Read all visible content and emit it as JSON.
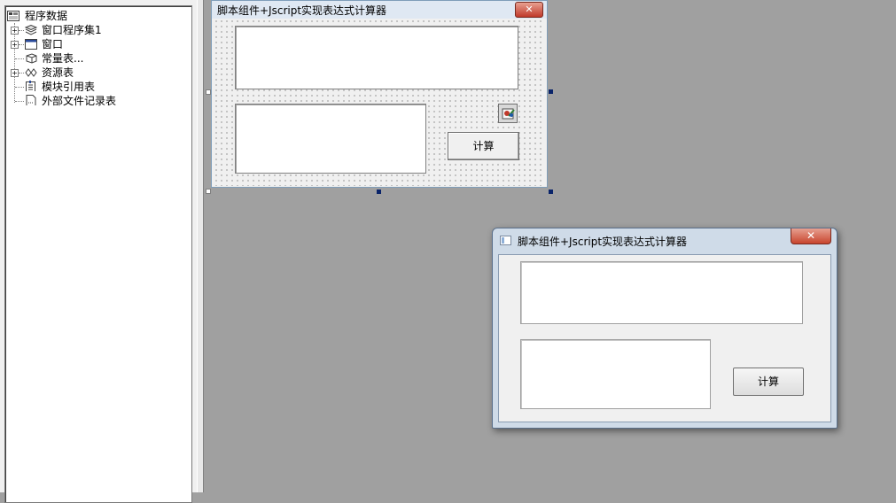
{
  "tree": {
    "root": "程序数据",
    "items": [
      {
        "label": "窗口程序集1",
        "expandable": true,
        "icon": "layers-icon"
      },
      {
        "label": "窗口",
        "expandable": true,
        "icon": "window-icon"
      },
      {
        "label": "常量表...",
        "expandable": false,
        "icon": "constants-icon"
      },
      {
        "label": "资源表",
        "expandable": true,
        "icon": "resources-icon"
      },
      {
        "label": "模块引用表",
        "expandable": false,
        "icon": "module-ref-icon"
      },
      {
        "label": "外部文件记录表",
        "expandable": false,
        "icon": "file-record-icon"
      }
    ]
  },
  "design_form": {
    "title": "脚本组件+Jscript实现表达式计算器",
    "button_label": "计算",
    "close_glyph": "✕"
  },
  "run_window": {
    "title": "脚本组件+Jscript实现表达式计算器",
    "button_label": "计算",
    "close_glyph": "✕"
  },
  "colors": {
    "workspace": "#a0a0a0",
    "selection_handle": "#0a246a",
    "close_button": "#c8452e"
  }
}
